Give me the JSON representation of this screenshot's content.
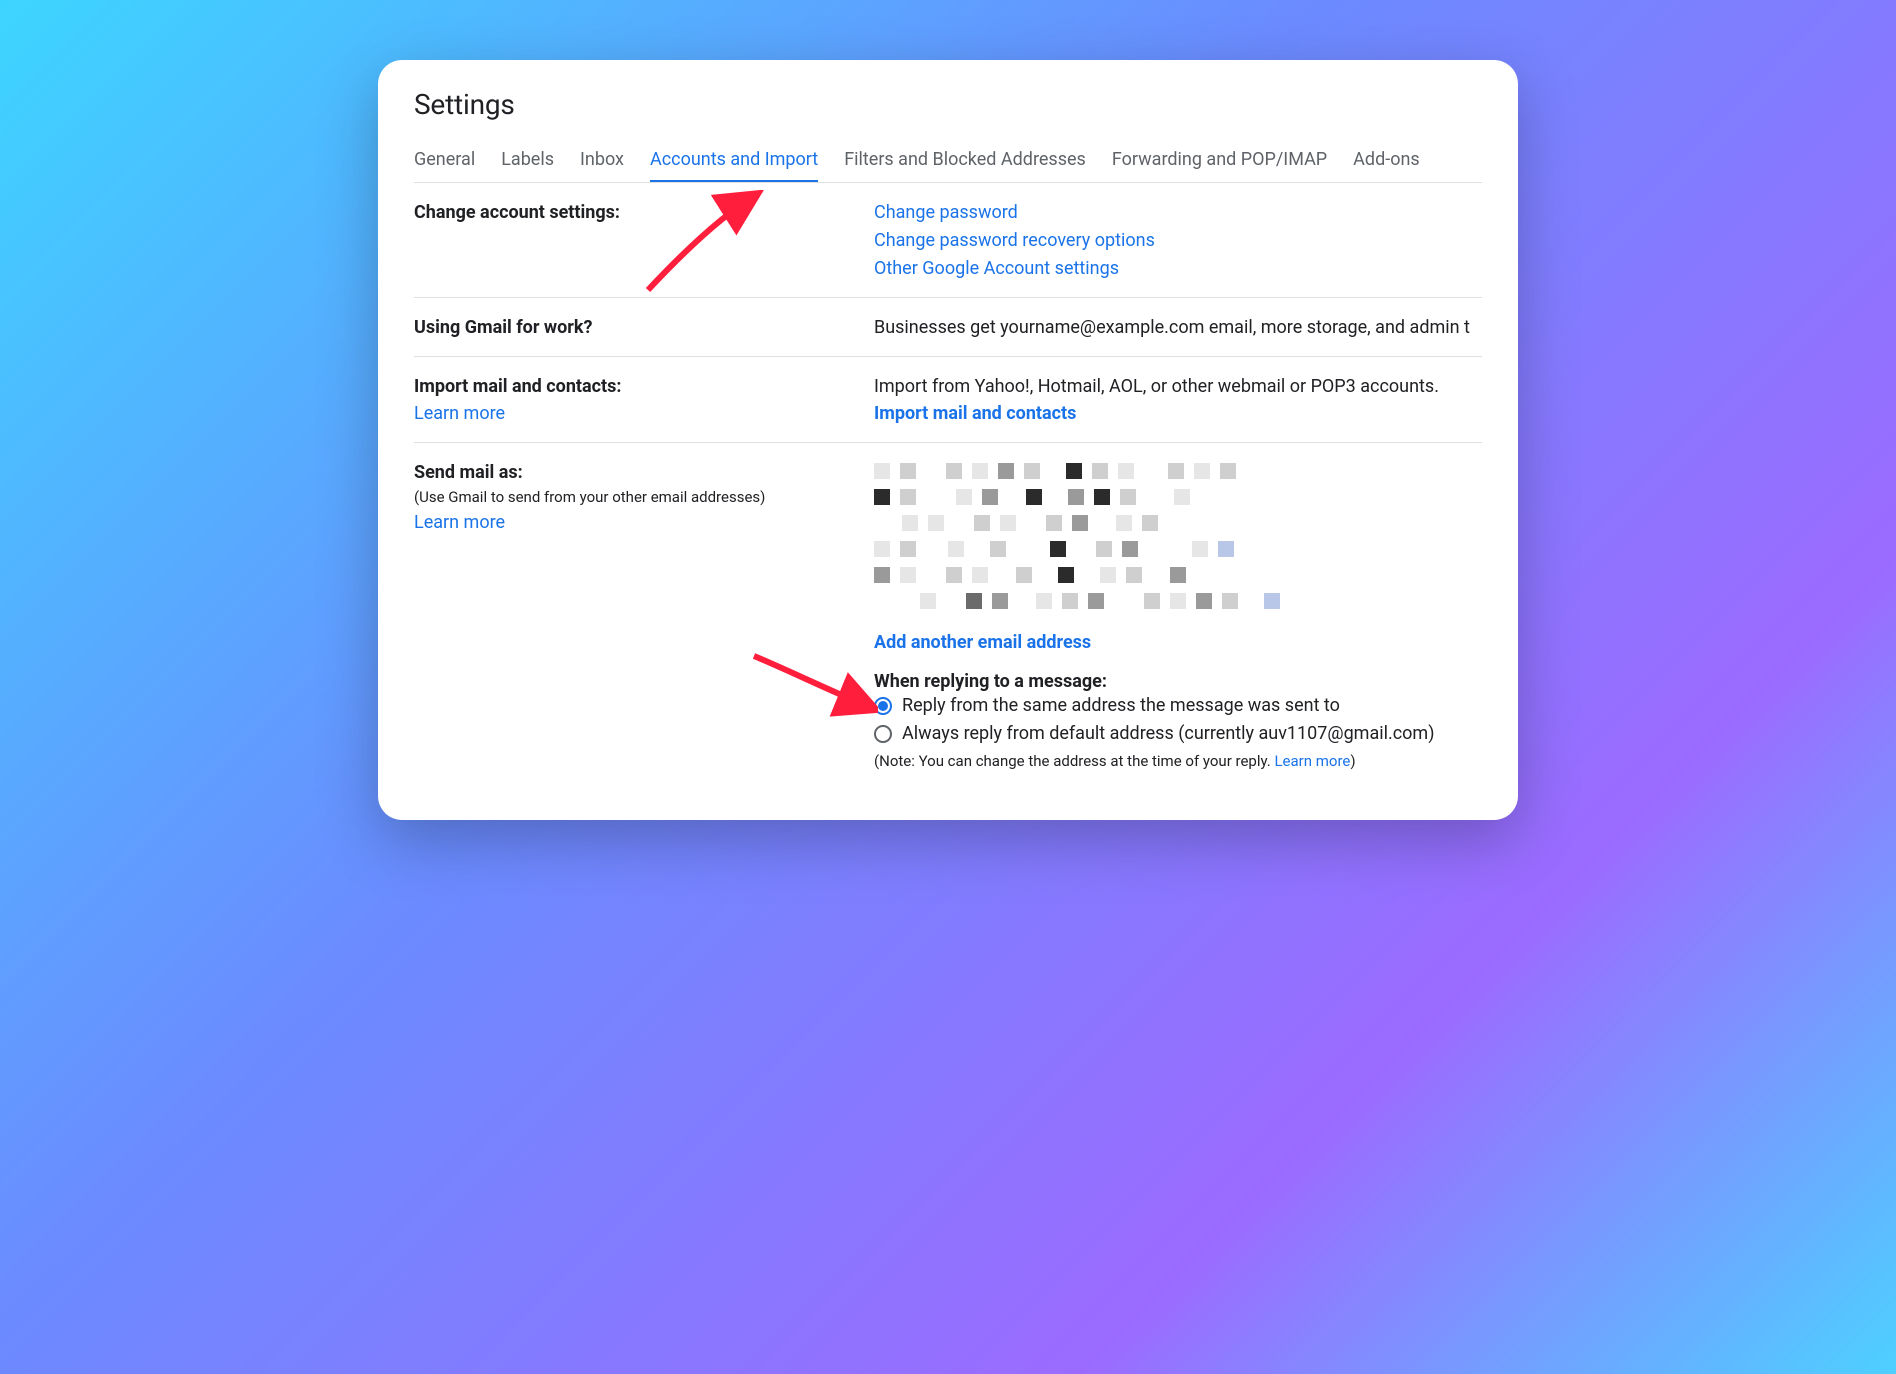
{
  "page_title": "Settings",
  "tabs": [
    {
      "label": "General",
      "active": false
    },
    {
      "label": "Labels",
      "active": false
    },
    {
      "label": "Inbox",
      "active": false
    },
    {
      "label": "Accounts and Import",
      "active": true
    },
    {
      "label": "Filters and Blocked Addresses",
      "active": false
    },
    {
      "label": "Forwarding and POP/IMAP",
      "active": false
    },
    {
      "label": "Add-ons",
      "active": false
    }
  ],
  "sections": {
    "change_account": {
      "title": "Change account settings:",
      "links": [
        "Change password",
        "Change password recovery options",
        "Other Google Account settings"
      ]
    },
    "work": {
      "title": "Using Gmail for work?",
      "body": "Businesses get yourname@example.com email, more storage, and admin t"
    },
    "import": {
      "title": "Import mail and contacts:",
      "learn_more": "Learn more",
      "body": "Import from Yahoo!, Hotmail, AOL, or other webmail or POP3 accounts.",
      "action": "Import mail and contacts"
    },
    "send_as": {
      "title": "Send mail as:",
      "sub": "(Use Gmail to send from your other email addresses)",
      "learn_more": "Learn more",
      "add_link": "Add another email address",
      "reply_heading": "When replying to a message:",
      "radio1": "Reply from the same address the message was sent to",
      "radio2": "Always reply from default address (currently auv1107@gmail.com)",
      "note_prefix": "(Note: You can change the address at the time of your reply. ",
      "note_link": "Learn more",
      "note_suffix": ")"
    }
  }
}
